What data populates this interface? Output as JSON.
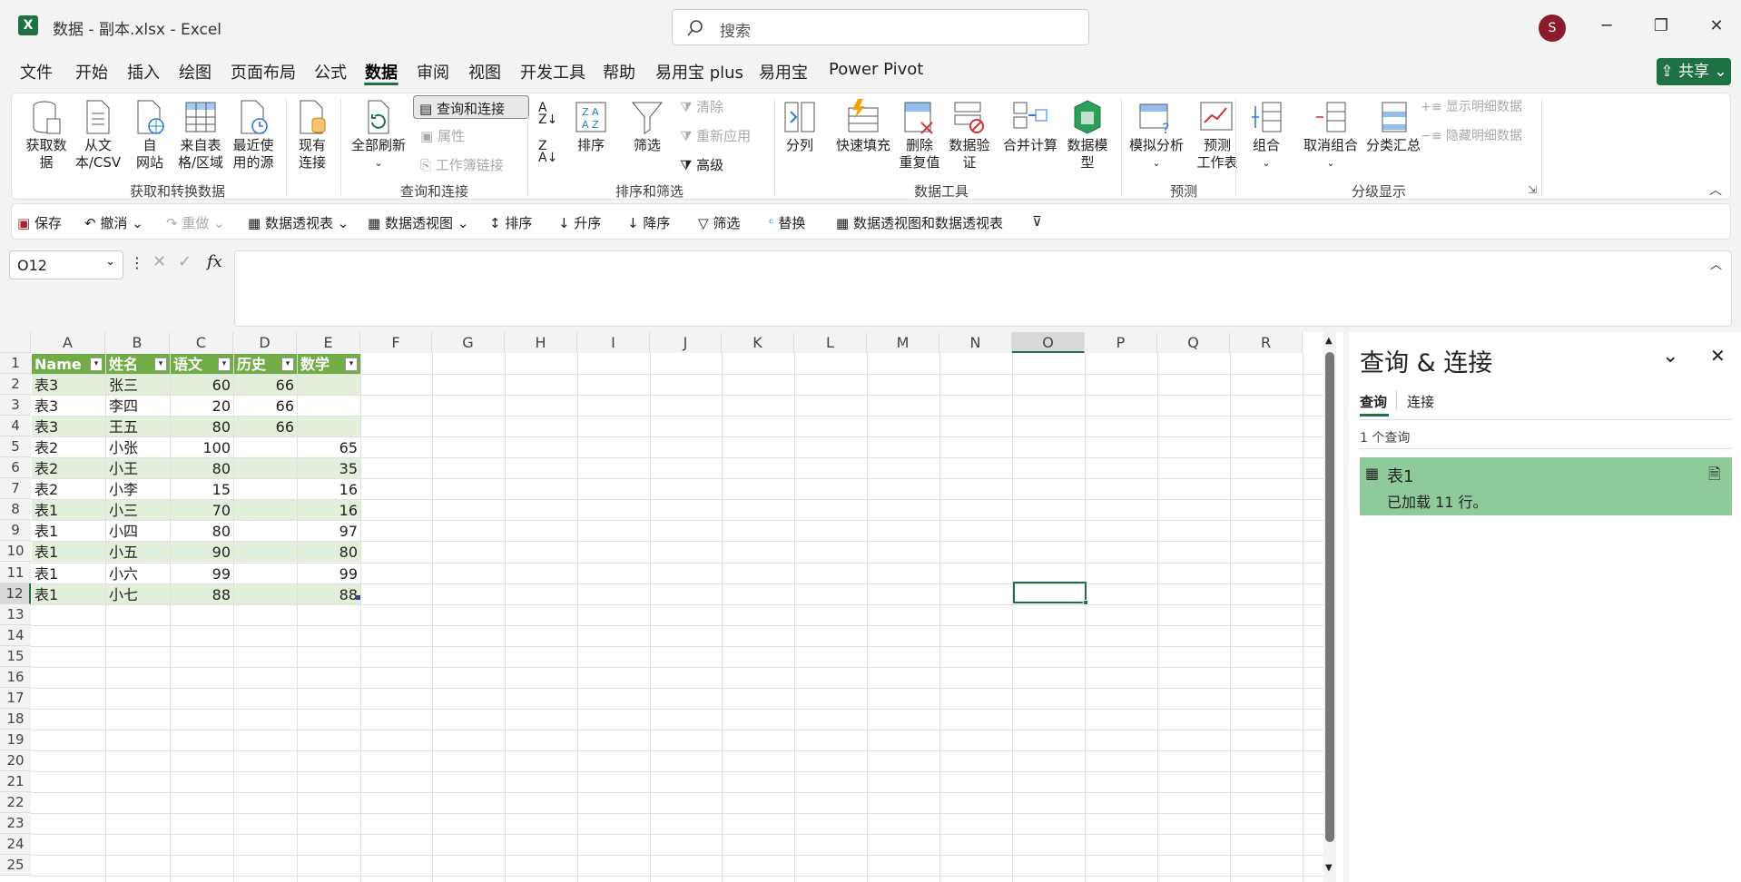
{
  "window": {
    "title": "数据 - 副本.xlsx  -  Excel",
    "search_placeholder": "搜索",
    "avatar": "S",
    "share": "共享"
  },
  "menu": [
    "文件",
    "开始",
    "插入",
    "绘图",
    "页面布局",
    "公式",
    "数据",
    "审阅",
    "视图",
    "开发工具",
    "帮助",
    "易用宝 plus",
    "易用宝",
    "Power Pivot"
  ],
  "ribbon": {
    "get_data": "获取数\n据",
    "from_csv": "从文\n本/CSV",
    "from_web": "自\n网站",
    "from_table": "来自表\n格/区域",
    "recent": "最近使\n用的源",
    "existing": "现有\n连接",
    "group_get": "获取和转换数据",
    "refresh_all": "全部刷新",
    "queries_conn": "查询和连接",
    "properties": "属性",
    "edit_links": "工作簿链接",
    "group_query": "查询和连接",
    "sort": "排序",
    "filter": "筛选",
    "clear": "清除",
    "reapply": "重新应用",
    "advanced": "高级",
    "group_sort": "排序和筛选",
    "text_to_col": "分列",
    "flash_fill": "快速填充",
    "remove_dup": "删除\n重复值",
    "validation": "数据验\n证",
    "consolidate": "合并计算",
    "data_model": "数据模\n型",
    "group_tools": "数据工具",
    "whatif": "模拟分析",
    "forecast": "预测\n工作表",
    "group_forecast": "预测",
    "group_btn": "组合",
    "ungroup": "取消组合",
    "subtotal": "分类汇总",
    "show_detail": "显示明细数据",
    "hide_detail": "隐藏明细数据",
    "group_outline": "分级显示"
  },
  "qat": [
    "保存",
    "撤消",
    "重做",
    "数据透视表",
    "数据透视图",
    "排序",
    "升序",
    "降序",
    "筛选",
    "替换",
    "数据透视图和数据透视表"
  ],
  "namebox": "O12",
  "fx": "fx",
  "columns": [
    "A",
    "B",
    "C",
    "D",
    "E",
    "F",
    "G",
    "H",
    "I",
    "J",
    "K",
    "L",
    "M",
    "N",
    "O",
    "P",
    "Q",
    "R"
  ],
  "rows": [
    "1",
    "2",
    "3",
    "4",
    "5",
    "6",
    "7",
    "8",
    "9",
    "10",
    "11",
    "12",
    "13",
    "14",
    "15",
    "16",
    "17",
    "18",
    "19",
    "20",
    "21",
    "22",
    "23",
    "24",
    "25"
  ],
  "table": {
    "headers": [
      "Name",
      "姓名",
      "语文",
      "历史",
      "数学"
    ],
    "data": [
      [
        "表3",
        "张三",
        "60",
        "66",
        ""
      ],
      [
        "表3",
        "李四",
        "20",
        "66",
        ""
      ],
      [
        "表3",
        "王五",
        "80",
        "66",
        ""
      ],
      [
        "表2",
        "小张",
        "100",
        "",
        "65"
      ],
      [
        "表2",
        "小王",
        "80",
        "",
        "35"
      ],
      [
        "表2",
        "小李",
        "15",
        "",
        "16"
      ],
      [
        "表1",
        "小三",
        "70",
        "",
        "16"
      ],
      [
        "表1",
        "小四",
        "80",
        "",
        "97"
      ],
      [
        "表1",
        "小五",
        "90",
        "",
        "80"
      ],
      [
        "表1",
        "小六",
        "99",
        "",
        "99"
      ],
      [
        "表1",
        "小七",
        "88",
        "",
        "88"
      ]
    ]
  },
  "pane": {
    "title": "查询 & 连接",
    "tab_queries": "查询",
    "tab_conn": "连接",
    "count": "1 个查询",
    "query_name": "表1",
    "query_status": "已加载 11 行。"
  },
  "colors": {
    "accent": "#1e7145",
    "table_header": "#70ad47",
    "band": "#e2efda",
    "query_item": "#8fca9b"
  }
}
